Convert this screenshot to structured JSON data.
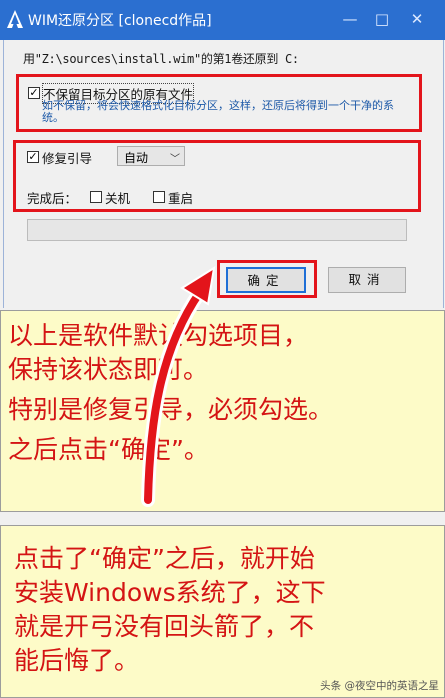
{
  "window": {
    "title": "WIM还原分区  [clonecd作品]",
    "minimize": "—",
    "maximize": "□",
    "close": "✕"
  },
  "info": "用\"Z:\\sources\\install.wim\"的第1卷还原到 C:",
  "options": {
    "keep_files_label": "不保留目标分区的原有文件",
    "keep_files_checked": true,
    "keep_files_desc": "如不保留，将会快速格式化目标分区，这样，还原后将得到一个干净的系统。",
    "repair_boot_label": "修复引导",
    "repair_boot_checked": true,
    "repair_boot_mode": "自动",
    "after_label": "完成后：",
    "shutdown_label": "关机",
    "shutdown_checked": false,
    "restart_label": "重启",
    "restart_checked": false
  },
  "progress": {
    "value": 0
  },
  "buttons": {
    "ok": "确定",
    "cancel": "取消"
  },
  "note1": {
    "line1": "以上是软件默认勾选项目，",
    "line2": "保持该状态即可。",
    "line3": "特别是修复引导，必须勾选。",
    "line4": "之后点击“确定”。"
  },
  "note2": {
    "line1": "点击了“确定”之后，就开始",
    "line2": "安装Windows系统了，这下",
    "line3": "就是开弓没有回头箭了，不",
    "line4": "能后悔了。"
  },
  "watermark": "头条 @夜空中的英语之星",
  "colors": {
    "titlebar": "#2b6fd0",
    "highlight": "#e3141b",
    "note_bg": "#fdfbc8",
    "note_text": "#d41414"
  }
}
